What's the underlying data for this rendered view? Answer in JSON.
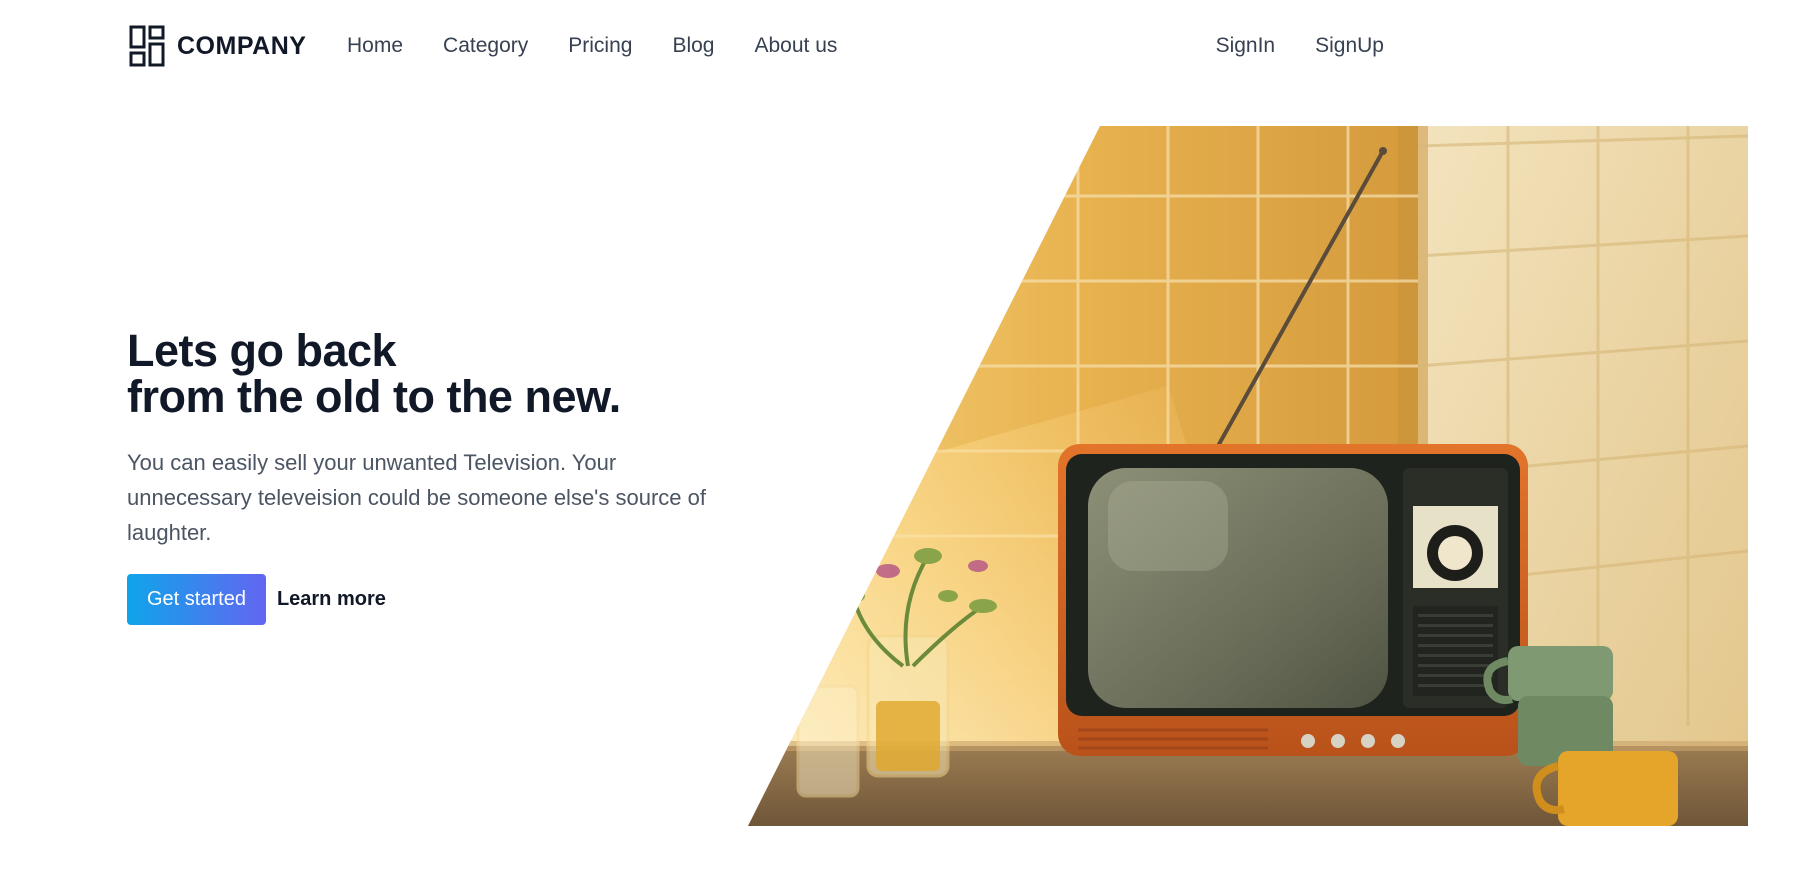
{
  "brand": {
    "name": "COMPANY",
    "icon": "dashboard-grid-icon"
  },
  "nav": {
    "items": [
      {
        "label": "Home"
      },
      {
        "label": "Category"
      },
      {
        "label": "Pricing"
      },
      {
        "label": "Blog"
      },
      {
        "label": "About us"
      }
    ],
    "signin_label": "SignIn",
    "signup_label": "SignUp"
  },
  "hero": {
    "title_line1": "Lets go back",
    "title_line2": "from the old to the new.",
    "description": "You can easily sell your unwanted Television. Your unnecessary televeision could be someone else's source of laughter.",
    "primary_button": "Get started",
    "secondary_link": "Learn more",
    "image": "vintage-orange-television-photo"
  },
  "colors": {
    "text_dark": "#111827",
    "text_muted": "#4b5563",
    "button_gradient_start": "#0ea5e9",
    "button_gradient_end": "#6366f1",
    "tv_orange": "#d9661d"
  }
}
